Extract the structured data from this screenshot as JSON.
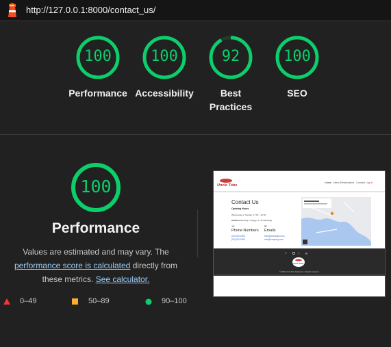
{
  "url": "http://127.0.0.1:8000/contact_us/",
  "summary_scores": [
    {
      "label": "Performance",
      "score": "100",
      "fraction": 1.0
    },
    {
      "label": "Accessibility",
      "score": "100",
      "fraction": 1.0
    },
    {
      "label_line1": "Best",
      "label_line2": "Practices",
      "score": "92",
      "fraction": 0.92
    },
    {
      "label": "SEO",
      "score": "100",
      "fraction": 1.0
    }
  ],
  "performance": {
    "score": "100",
    "title": "Performance",
    "desc_prefix": "Values are estimated and may vary. The",
    "desc_link1": "performance score is calculated",
    "desc_mid": "directly from these metrics.",
    "desc_link2": "See calculator."
  },
  "legend": [
    {
      "range": "0–49",
      "color": "#ff3333"
    },
    {
      "range": "50–89",
      "color": "#ffaa33"
    },
    {
      "range": "90–100",
      "color": "#0cce6b"
    }
  ],
  "colors": {
    "pass": "#0cce6b",
    "background": "#212121"
  },
  "thumbnail": {
    "nav": [
      "Home",
      "Menu",
      "Reservation",
      "Contact",
      "Log-in"
    ],
    "heading": "Contact Us",
    "opening_hours": "Opening Hours",
    "hours_text": "Wednesday to Sunday: 17:00 – 22:00",
    "address_label": "Address:",
    "address_text": "Nanalogi, Gruggy, G7 (E.Nanalogi)",
    "phone_heading": "Phone Numbers",
    "phones": [
      "(00) 000-0000",
      "(00) 000-0000"
    ],
    "email_heading": "Emails",
    "emails": [
      "hello@company.com",
      "info@company.com"
    ],
    "footer": "© 2024 Uncle Tobs Restaurant. All rights reserved."
  }
}
